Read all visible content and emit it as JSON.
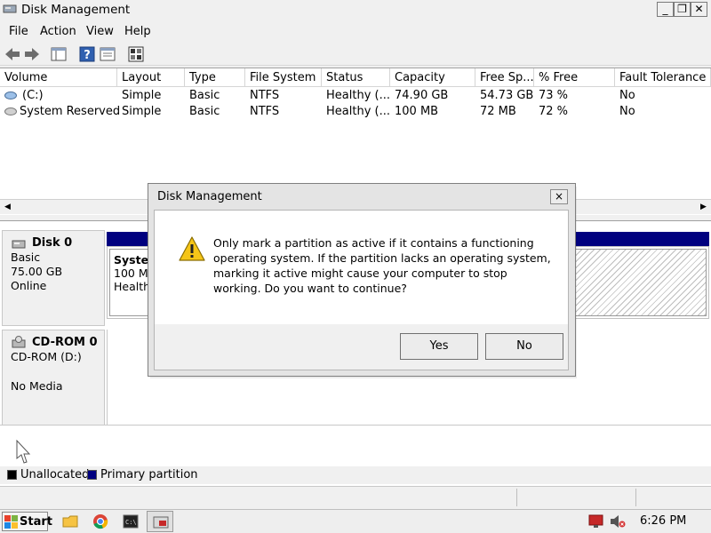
{
  "window": {
    "title": "Disk Management"
  },
  "menu": {
    "items": [
      "File",
      "Action",
      "View",
      "Help"
    ]
  },
  "table": {
    "columns": [
      "Volume",
      "Layout",
      "Type",
      "File System",
      "Status",
      "Capacity",
      "Free Sp...",
      "% Free",
      "Fault Tolerance"
    ],
    "rows": [
      {
        "volume": "(C:)",
        "layout": "Simple",
        "type": "Basic",
        "fs": "NTFS",
        "status": "Healthy (...",
        "capacity": "74.90 GB",
        "free": "54.73 GB",
        "pct_free": "73 %",
        "fault": "No"
      },
      {
        "volume": "System Reserved",
        "layout": "Simple",
        "type": "Basic",
        "fs": "NTFS",
        "status": "Healthy (...",
        "capacity": "100 MB",
        "free": "72 MB",
        "pct_free": "72 %",
        "fault": "No"
      }
    ]
  },
  "disks": [
    {
      "name": "Disk 0",
      "kind": "Basic",
      "size": "75.00 GB",
      "state": "Online"
    },
    {
      "name": "CD-ROM 0",
      "kind": "CD-ROM (D:)",
      "size": "",
      "state": "No Media"
    }
  ],
  "partition": {
    "name": "Systen",
    "size": "100 MI",
    "status": "Healthy"
  },
  "legend": {
    "unallocated": "Unallocated",
    "primary": "Primary partition"
  },
  "colors": {
    "primary": "#00007f",
    "unallocated": "#000000"
  },
  "dialog": {
    "title": "Disk Management",
    "message": "Only mark a partition as active if it contains a functioning operating system. If the partition lacks an operating system, marking it active might cause your computer to stop working. Do you want to continue?",
    "yes_label": "Yes",
    "no_label": "No",
    "close_glyph": "×"
  },
  "taskbar": {
    "start_label": "Start",
    "clock": "6:26 PM"
  }
}
